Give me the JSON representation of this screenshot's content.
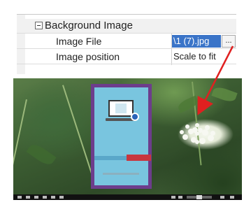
{
  "property_grid": {
    "category": {
      "label": "Background Image"
    },
    "rows": [
      {
        "name": "Image File",
        "value": "\\1 (7).jpg"
      },
      {
        "name": "Image position",
        "value": "Scale to fit"
      }
    ],
    "browse_button_label": "..."
  },
  "colors": {
    "selection_highlight": "#3a74c8",
    "arrow": "#e02020",
    "book_frame": "#6d3d8c",
    "book_page": "#79c5df",
    "toolbar": "#111111"
  },
  "preview": {
    "icons": [
      "laptop-icon",
      "flower-image",
      "red-arrow-annotation"
    ]
  }
}
